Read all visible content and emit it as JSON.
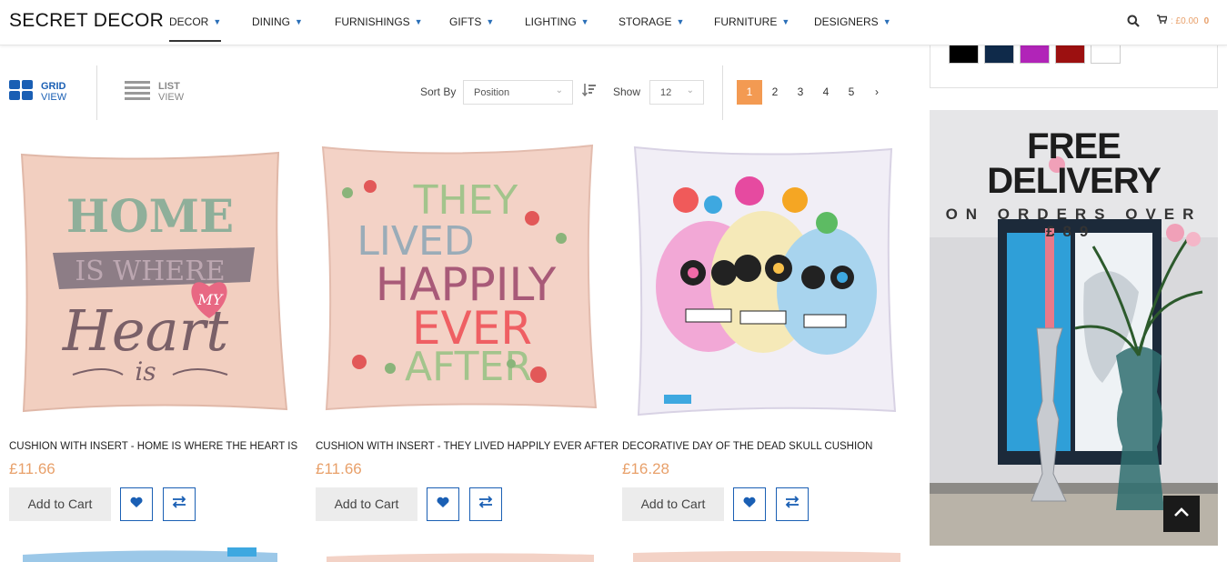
{
  "header": {
    "logo": "SECRET DECOR",
    "nav": [
      {
        "label": "DECOR",
        "active": true
      },
      {
        "label": "DINING"
      },
      {
        "label": "FURNISHINGS"
      },
      {
        "label": "GIFTS"
      },
      {
        "label": "LIGHTING"
      },
      {
        "label": "STORAGE"
      },
      {
        "label": "FURNITURE"
      },
      {
        "label": "DESIGNERS"
      }
    ],
    "cart_amount": ": £0.00",
    "cart_count": "0"
  },
  "toolbar": {
    "grid_label": "GRID",
    "grid_sub": "VIEW",
    "list_label": "LIST",
    "list_sub": "VIEW",
    "sort_label": "Sort By",
    "sort_value": "Position",
    "show_label": "Show",
    "show_value": "12",
    "pages": [
      "1",
      "2",
      "3",
      "4",
      "5"
    ],
    "current_page": "1",
    "next_icon": "chevron-right-icon"
  },
  "products": [
    {
      "name": "CUSHION WITH INSERT - HOME IS WHERE THE HEART IS",
      "price": "£11.66",
      "cart_label": "Add to Cart",
      "art": [
        "HOME",
        "IS WHERE",
        "MY",
        "Heart",
        "is"
      ]
    },
    {
      "name": "CUSHION WITH INSERT - THEY LIVED HAPPILY EVER AFTER",
      "price": "£11.66",
      "cart_label": "Add to Cart",
      "art": [
        "THEY",
        "LIVED",
        "HAPPILY",
        "EVER",
        "AFTER"
      ]
    },
    {
      "name": "DECORATIVE DAY OF THE DEAD SKULL CUSHION",
      "price": "£16.28",
      "cart_label": "Add to Cart",
      "art": []
    }
  ],
  "sidebar": {
    "swatches": [
      "#000000",
      "#0f2a4a",
      "#b124b8",
      "#9c1010",
      "#ffffff"
    ],
    "banner_line1": "FREE",
    "banner_line2": "DELIVERY",
    "banner_line3": "ON ORDERS OVER",
    "banner_line4": "£89"
  },
  "colors": {
    "accent_blue": "#1a5fb4",
    "price_orange": "#e8a06a",
    "page_active": "#f39a52"
  }
}
